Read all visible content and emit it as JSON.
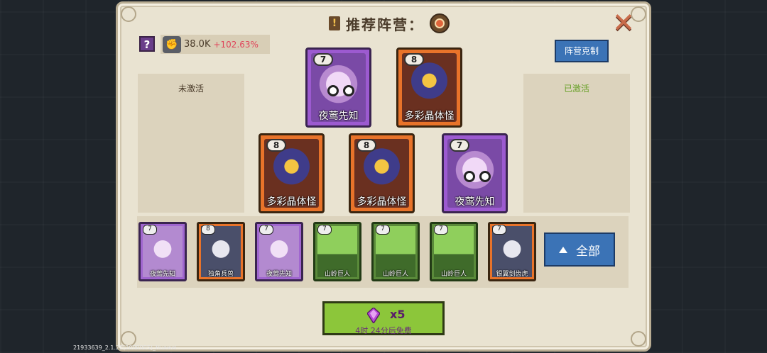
{
  "title": "推荐阵营：",
  "help_label": "?",
  "power": {
    "value": "38.0K",
    "delta": "+102.63%"
  },
  "counter_button": "阵营克制",
  "inactive_label": "未激活",
  "active_label": "已激活",
  "board": [
    {
      "level": "7",
      "name": "夜莺先知",
      "rarity": "purple"
    },
    {
      "level": "8",
      "name": "多彩晶体怪",
      "rarity": "orange"
    },
    {
      "level": "8",
      "name": "多彩晶体怪",
      "rarity": "orange"
    },
    {
      "level": "8",
      "name": "多彩晶体怪",
      "rarity": "orange"
    },
    {
      "level": "7",
      "name": "夜莺先知",
      "rarity": "purple"
    }
  ],
  "pool": [
    {
      "level": "7",
      "name": "夜莺先知",
      "rarity": "purple"
    },
    {
      "level": "8",
      "name": "独角兵兽",
      "rarity": "orange"
    },
    {
      "level": "7",
      "name": "夜莺先知",
      "rarity": "purple"
    },
    {
      "level": "7",
      "name": "山岭巨人",
      "rarity": "green"
    },
    {
      "level": "7",
      "name": "山岭巨人",
      "rarity": "green"
    },
    {
      "level": "7",
      "name": "山岭巨人",
      "rarity": "green"
    },
    {
      "level": "7",
      "name": "银翼剑齿虎",
      "rarity": "orange"
    }
  ],
  "all_button": "全部",
  "refresh": {
    "quantity": "x5",
    "free_text": "4时 24分后免费"
  },
  "version": "21933639_2.1.22(2000005)_Huawei",
  "colors": {
    "panel": "#e9e3d1",
    "button_blue": "#3b73b6",
    "refresh_green": "#8cc63a",
    "active_green": "#6aa12a"
  }
}
